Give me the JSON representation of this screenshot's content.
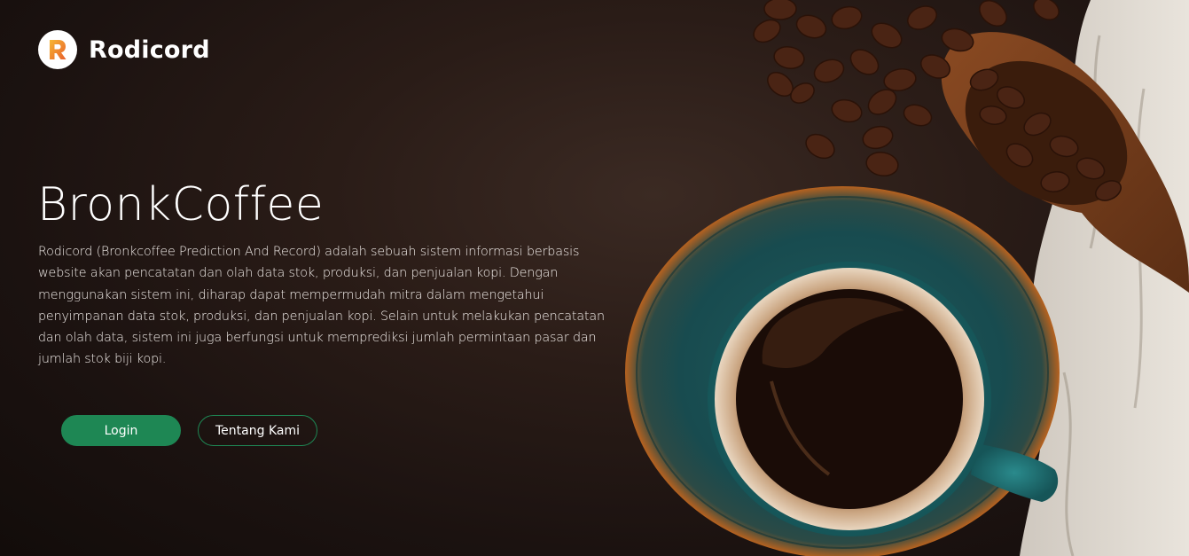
{
  "brand": {
    "logo_icon": "rodicord-r-logo-icon",
    "name": "Rodicord"
  },
  "hero": {
    "title": "BronkCoffee",
    "description": "Rodicord (Bronkcoffee Prediction And Record) adalah sebuah sistem informasi berbasis website akan pencatatan dan olah data stok, produksi, dan penjualan kopi. Dengan menggunakan sistem ini, diharap dapat mempermudah mitra dalam mengetahui penyimpanan data stok, produksi, dan penjualan kopi. Selain untuk melakukan pencatatan dan olah data, sistem ini juga berfungsi untuk memprediksi jumlah permintaan pasar dan jumlah stok biji kopi."
  },
  "actions": {
    "login_label": "Login",
    "about_label": "Tentang Kami"
  },
  "colors": {
    "accent": "#1e8754",
    "background": "#2a1c17",
    "text": "#ffffff"
  }
}
